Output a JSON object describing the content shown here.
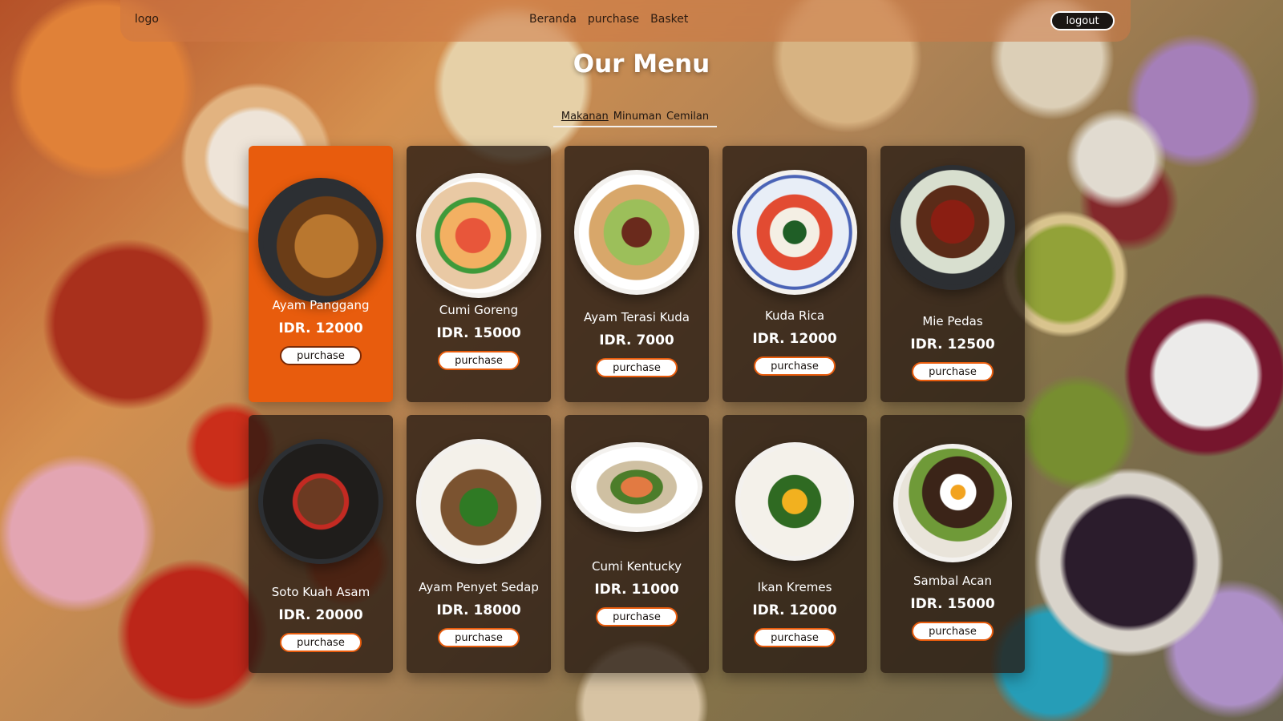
{
  "navbar": {
    "logo": "logo",
    "links": [
      "Beranda",
      "purchase",
      "Basket"
    ],
    "logout": "logout"
  },
  "heading": "Our Menu",
  "tabs": [
    "Makanan",
    "Minuman",
    "Cemilan"
  ],
  "menu": [
    {
      "name": "Ayam Panggang",
      "price": "IDR. 12000",
      "button": "purchase",
      "highlighted": true,
      "icon": "noodle-bowl-image"
    },
    {
      "name": "Cumi Goreng",
      "price": "IDR. 15000",
      "button": "purchase",
      "highlighted": false,
      "icon": "soup-bowl-image"
    },
    {
      "name": "Ayam Terasi Kuda",
      "price": "IDR. 7000",
      "button": "purchase",
      "highlighted": false,
      "icon": "salad-plate-image"
    },
    {
      "name": "Kuda Rica",
      "price": "IDR. 12000",
      "button": "purchase",
      "highlighted": false,
      "icon": "caprese-plate-image"
    },
    {
      "name": "Mie Pedas",
      "price": "IDR. 12500",
      "button": "purchase",
      "highlighted": false,
      "icon": "skewer-plate-image"
    },
    {
      "name": "Soto Kuah Asam",
      "price": "IDR. 20000",
      "button": "purchase",
      "highlighted": false,
      "icon": "steak-board-image"
    },
    {
      "name": "Ayam Penyet Sedap",
      "price": "IDR. 18000",
      "button": "purchase",
      "highlighted": false,
      "icon": "green-beans-plate-image"
    },
    {
      "name": "Cumi Kentucky",
      "price": "IDR. 11000",
      "button": "purchase",
      "highlighted": false,
      "icon": "salmon-plate-image"
    },
    {
      "name": "Ikan Kremes",
      "price": "IDR. 12000",
      "button": "purchase",
      "highlighted": false,
      "icon": "eggs-benedict-plate-image"
    },
    {
      "name": "Sambal Acan",
      "price": "IDR. 15000",
      "button": "purchase",
      "highlighted": false,
      "icon": "fried-egg-plate-image"
    }
  ],
  "colors": {
    "accent": "#e85c0d",
    "card": "#261a12",
    "text": "#ffffff"
  }
}
